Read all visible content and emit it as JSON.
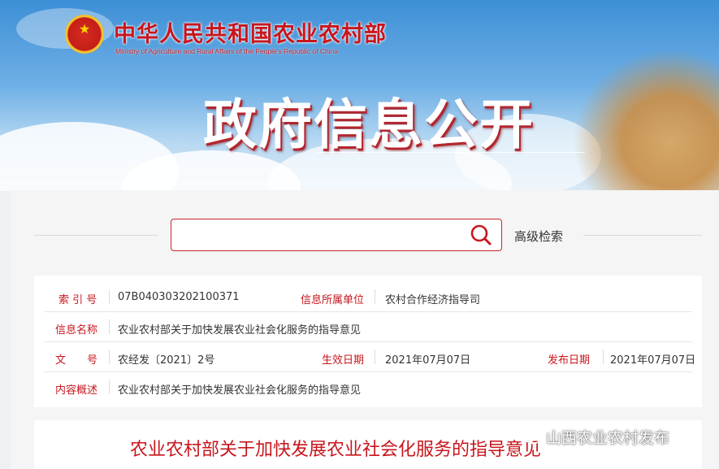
{
  "header": {
    "ministry_cn": "中华人民共和国农业农村部",
    "ministry_en": "Ministry of Agriculture and Rural Affairs of the People's Republic of China",
    "page_title": "政府信息公开"
  },
  "search": {
    "placeholder": "",
    "advanced_label": "高级检索"
  },
  "info": {
    "index_label": "索 引 号",
    "index_value": "07B040303202100371",
    "owner_label": "信息所属单位",
    "owner_value": "农村合作经济指导司",
    "name_label": "信息名称",
    "name_value": "农业农村部关于加快发展农业社会化服务的指导意见",
    "doc_label": "文　　号",
    "doc_value": "农经发〔2021〕2号",
    "effective_label": "生效日期",
    "effective_value": "2021年07月07日",
    "publish_label": "发布日期",
    "publish_value": "2021年07月07日",
    "summary_label": "内容概述",
    "summary_value": "农业农村部关于加快发展农业社会化服务的指导意见"
  },
  "article": {
    "title": "农业农村部关于加快发展农业社会化服务的指导意见"
  },
  "watermark": {
    "text": "山西农业农村发布"
  },
  "colors": {
    "brand_red": "#c8161d",
    "label_red": "#c8161d",
    "sky_blue": "#3d8fd6"
  }
}
